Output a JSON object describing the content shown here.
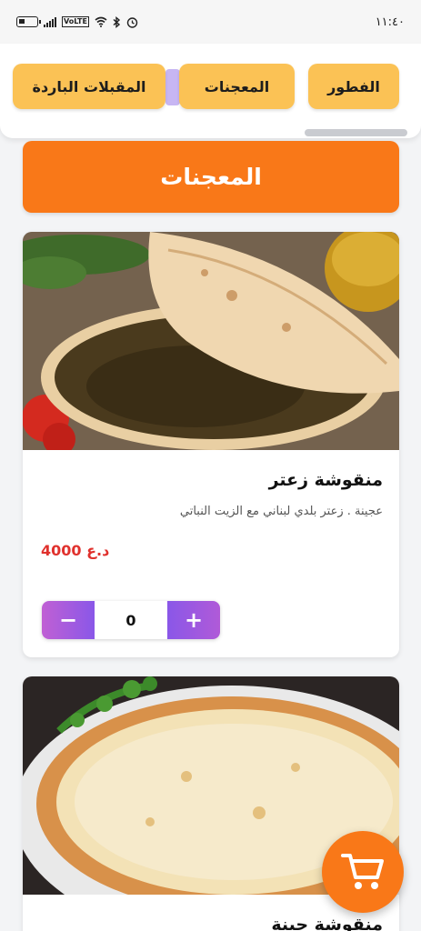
{
  "status_bar": {
    "time": "١١:٤٠",
    "icons": [
      "battery-icon",
      "signal-icon",
      "volte-icon",
      "wifi-icon",
      "bluetooth-icon",
      "alarm-icon"
    ],
    "volte_label": "VoLTE"
  },
  "categories": {
    "items": [
      {
        "label": "الفطور"
      },
      {
        "label": "المعجنات"
      },
      {
        "label": "المقبلات الباردة"
      }
    ]
  },
  "section": {
    "title": "المعجنات"
  },
  "products": [
    {
      "name": "منقوشة زعتر",
      "description": "عجينة . زعتر بلدي لبناني مع الزيت النباتي",
      "price": "4000 د.ع",
      "quantity": "0",
      "minus_label": "−",
      "plus_label": "+"
    },
    {
      "name": "منقوشة جبنة"
    }
  ],
  "colors": {
    "accent": "#f97818",
    "category_button": "#fbc255",
    "price": "#e0312d",
    "stepper_gradient_start": "#c060d4",
    "stepper_gradient_end": "#8a57e8"
  },
  "cart": {
    "icon": "cart-icon"
  }
}
